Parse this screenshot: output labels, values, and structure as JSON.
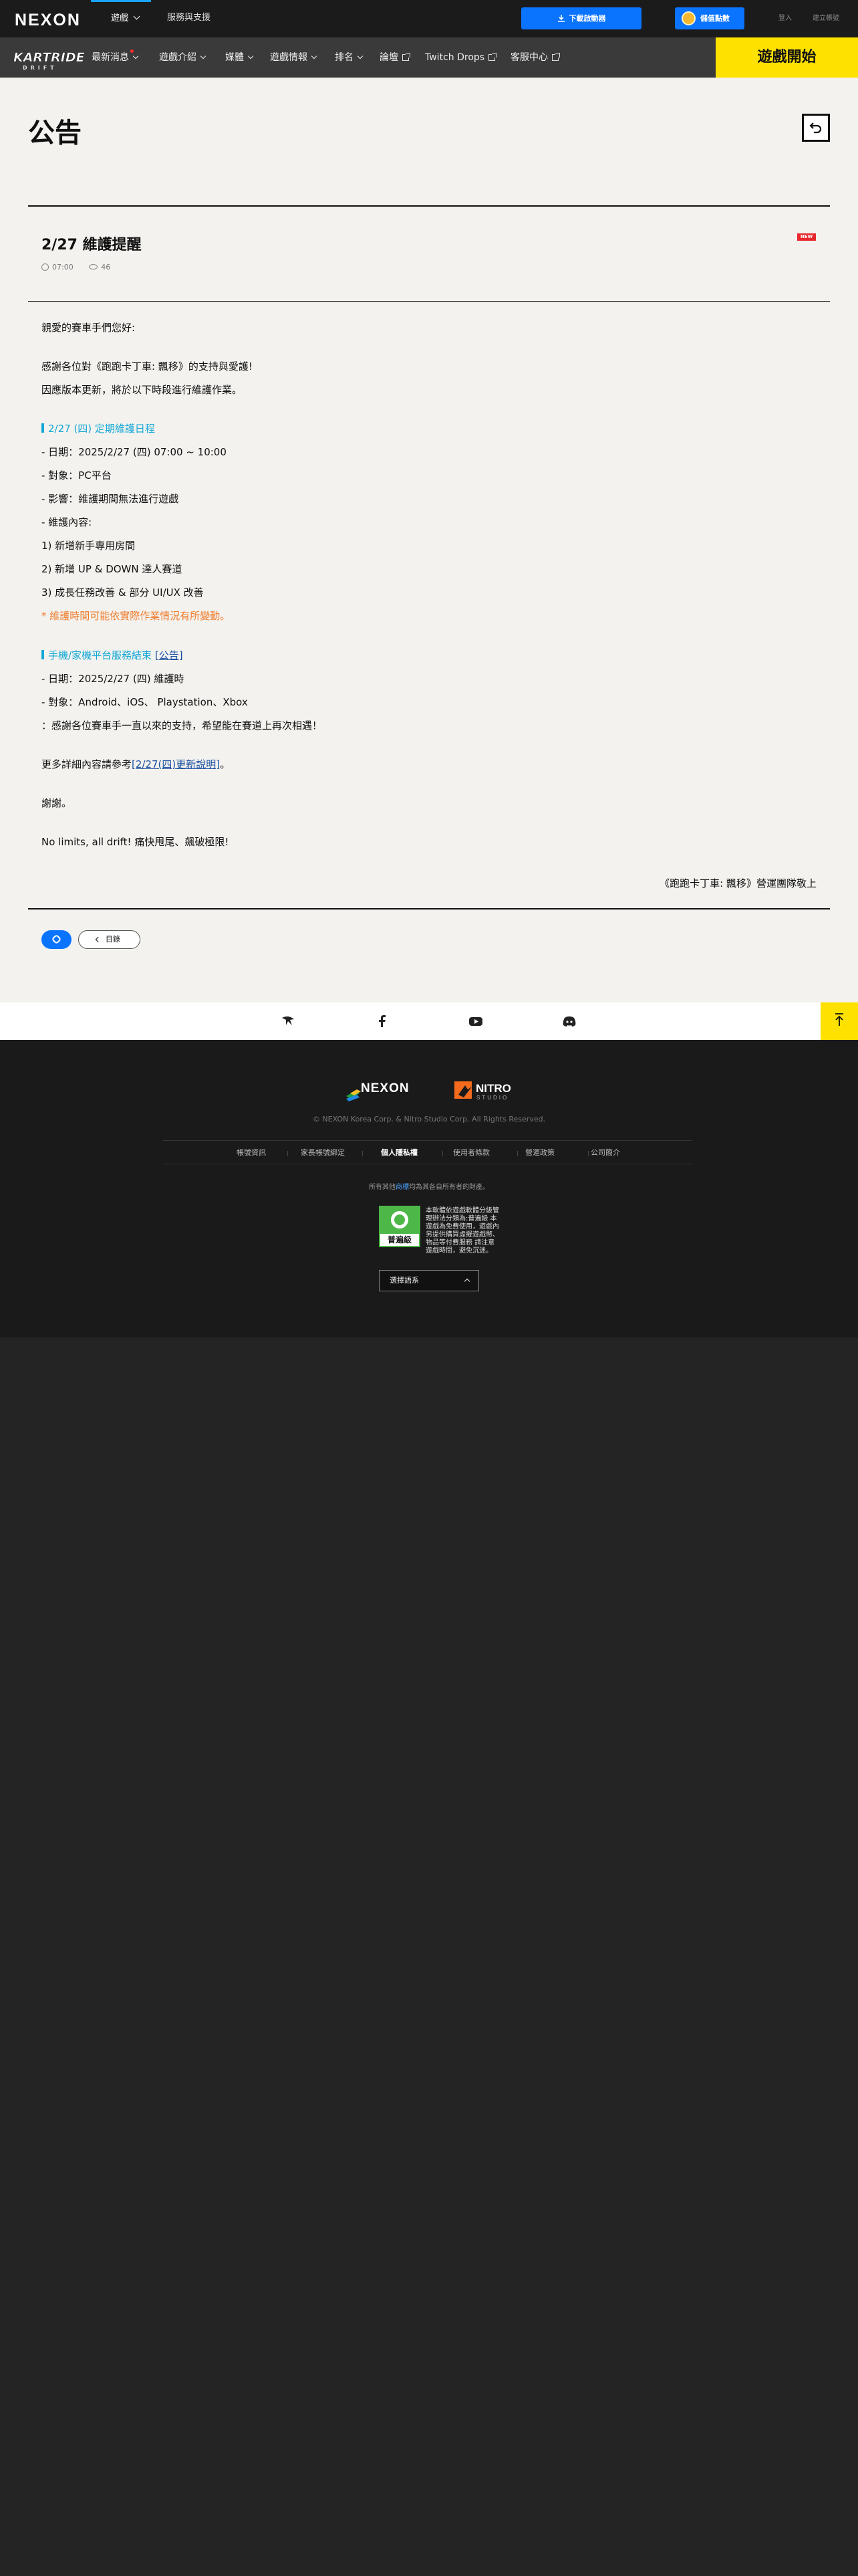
{
  "header": {
    "logo": "NEXON",
    "nav": [
      {
        "label": "遊戲"
      },
      {
        "label": "服務與支援"
      }
    ],
    "download_label": "下載啟動器",
    "coin_label": "儲值點數",
    "login_label": "登入",
    "signup_label": "建立帳號"
  },
  "game_nav": {
    "logo": "KARTRIDER DRIFT",
    "items": [
      {
        "label": "最新消息"
      },
      {
        "label": "遊戲介紹"
      },
      {
        "label": "媒體"
      },
      {
        "label": "遊戲情報"
      },
      {
        "label": "排名"
      },
      {
        "label": "論壇"
      },
      {
        "label": "Twitch Drops"
      },
      {
        "label": "客服中心"
      }
    ],
    "play_label": "遊戲開始"
  },
  "page": {
    "title": "公告"
  },
  "post": {
    "title": "2/27 維護提醒",
    "time": "07:00",
    "views": "46",
    "badge": "NEW",
    "lines": {
      "greeting": "親愛的賽車手們您好:",
      "thanks": "感謝各位對《跑跑卡丁車: 飄移》的支持與愛護!",
      "notice": "因應版本更新，將於以下時段進行維護作業。",
      "section1_title": "2/27 (四) 定期維護日程",
      "date1": "- 日期：2025/2/27 (四) 07:00 ~ 10:00",
      "target1": "- 對象：PC平台",
      "impact1": "- 影響：維護期間無法進行遊戲",
      "content_label": "- 維護內容:",
      "item1": "1) 新增新手專用房間",
      "item2": "2) 新增 UP & DOWN 達人賽道",
      "item3": "3) 成長任務改善 & 部分 UI/UX 改善",
      "warning": "* 維護時間可能依實際作業情況有所變動。",
      "section2_title": "手機/家機平台服務結束",
      "section2_link": "[公告]",
      "date2": "- 日期：2025/2/27 (四) 維護時",
      "target2": "- 對象：Android、iOS、 Playstation、Xbox",
      "farewell": "：感謝各位賽車手一直以來的支持，希望能在賽道上再次相遇！",
      "more_prefix": "更多詳細內容請參考",
      "more_link": "[2/27(四)更新說明]",
      "more_suffix": "。",
      "thanks_short": "謝謝。",
      "slogan": "No limits, all drift! 痛快甩尾、飆破極限!",
      "signature": "《跑跑卡丁車: 飄移》營運團隊敬上"
    },
    "list_button": "目錄"
  },
  "social": {
    "icons": [
      "nexon-bird-icon",
      "facebook-icon",
      "youtube-icon",
      "discord-icon"
    ]
  },
  "footer": {
    "logos": [
      "NEXON",
      "NITRO STUDIO"
    ],
    "copyright": "© NEXON Korea Corp. & Nitro Studio Corp. All Rights Reserved.",
    "links": [
      "帳號資訊",
      "家長帳號綁定",
      "個人隱私權",
      "使用者條款",
      "營運政策",
      "公司簡介"
    ],
    "trademark_prefix": "所有其他",
    "trademark_link": "商標",
    "trademark_suffix": "均為其各自所有者的財產。",
    "rating_label": "普遍級",
    "rating_text": "本軟體依遊戲軟體分級管理辦法分類為:普遍級 本遊戲為免費使用，遊戲內另提供購買虛擬遊戲幣、物品等付費服務 請注意遊戲時間，避免沉迷。",
    "language_label": "選擇語系"
  },
  "colors": {
    "accent_blue": "#0a74ff",
    "yellow": "#ffe100",
    "section_blue": "#12a7d6",
    "warning_orange": "#ef7c2d"
  }
}
